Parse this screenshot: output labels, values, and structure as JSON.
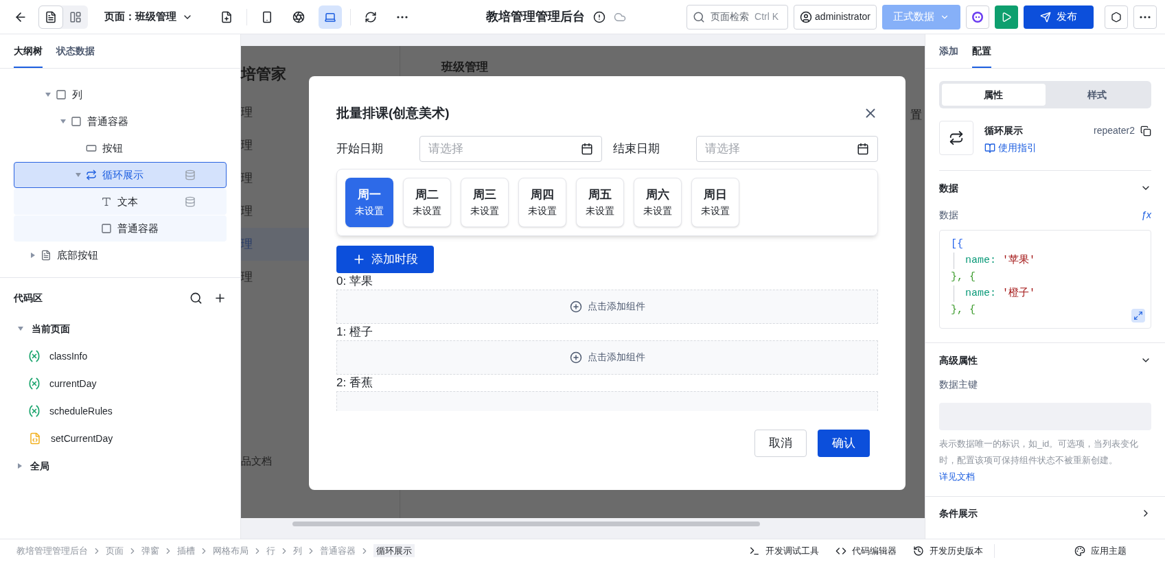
{
  "toolbar": {
    "view_modes": [
      {
        "kind": "page",
        "selected": true
      },
      {
        "kind": "layout",
        "selected": false
      }
    ],
    "page_selector": "页面：班级管理",
    "devices": [
      {
        "kind": "new-page",
        "selected": false
      },
      {
        "kind": "phone",
        "selected": false
      },
      {
        "kind": "mini",
        "selected": false
      },
      {
        "kind": "laptop",
        "selected": true
      },
      {
        "kind": "refresh",
        "selected": false
      },
      {
        "kind": "more",
        "selected": false
      }
    ],
    "title": "教培管理管理后台",
    "search": {
      "placeholder": "页面检索",
      "shortcut": "Ctrl K"
    },
    "user": "administrator",
    "environment": "正式数据",
    "publish": "发布"
  },
  "left_panel": {
    "tabs": [
      {
        "label": "大纲树",
        "selected": true
      },
      {
        "label": "状态数据",
        "selected": false
      }
    ],
    "outline": [
      {
        "children": [
          {
            "label": "列",
            "kind": "container",
            "expanded": true,
            "selected": false,
            "bound": false,
            "children": [
              {
                "label": "普通容器",
                "kind": "container",
                "expanded": true,
                "selected": false,
                "bound": false,
                "children": [
                  {
                    "label": "按钮",
                    "kind": "button",
                    "selected": false,
                    "bound": false
                  },
                  {
                    "label": "循环展示",
                    "kind": "repeater",
                    "expanded": true,
                    "selected": true,
                    "bound": true,
                    "children": [
                      {
                        "label": "文本",
                        "kind": "text",
                        "selected": false,
                        "bound": true
                      },
                      {
                        "label": "普通容器",
                        "kind": "container",
                        "selected": false,
                        "bound": false
                      }
                    ]
                  }
                ]
              }
            ]
          }
        ]
      },
      {
        "label": "底部按钮",
        "kind": "footer",
        "expanded": false,
        "selected": false,
        "bound": false
      }
    ],
    "code_area": {
      "title": "代码区",
      "groups": [
        {
          "label": "当前页面",
          "expanded": true,
          "items": [
            {
              "label": "classInfo",
              "kind": "variable"
            },
            {
              "label": "currentDay",
              "kind": "variable"
            },
            {
              "label": "scheduleRules",
              "kind": "variable"
            },
            {
              "label": "setCurrentDay",
              "kind": "function"
            }
          ]
        },
        {
          "label": "全局",
          "expanded": false
        }
      ]
    }
  },
  "canvas": {
    "brand": "培管家",
    "menu": [
      {
        "label": "理",
        "selected": false
      },
      {
        "label": "理",
        "selected": false
      },
      {
        "label": "理",
        "selected": false
      },
      {
        "label": "理",
        "selected": false
      },
      {
        "label": "理",
        "selected": true
      },
      {
        "label": "理",
        "selected": false
      }
    ],
    "menu_footer": "品文档",
    "page_title": "班级管理",
    "reset": "置"
  },
  "modal": {
    "title": "批量排课(创意美术)",
    "date_fields": [
      {
        "label": "开始日期",
        "placeholder": "请选择"
      },
      {
        "label": "结束日期",
        "placeholder": "请选择"
      }
    ],
    "days": [
      {
        "label": "周一",
        "status": "未设置",
        "selected": true
      },
      {
        "label": "周二",
        "status": "未设置",
        "selected": false
      },
      {
        "label": "周三",
        "status": "未设置",
        "selected": false
      },
      {
        "label": "周四",
        "status": "未设置",
        "selected": false
      },
      {
        "label": "周五",
        "status": "未设置",
        "selected": false
      },
      {
        "label": "周六",
        "status": "未设置",
        "selected": false
      },
      {
        "label": "周日",
        "status": "未设置",
        "selected": false
      }
    ],
    "add_button": "添加时段",
    "items": [
      {
        "label": "0: 苹果",
        "action": "点击添加组件"
      },
      {
        "label": "1: 橙子",
        "action": "点击添加组件"
      },
      {
        "label": "2: 香蕉"
      }
    ],
    "cancel": "取消",
    "confirm": "确认"
  },
  "right_panel": {
    "tabs": [
      {
        "label": "添加",
        "selected": false
      },
      {
        "label": "配置",
        "selected": true
      }
    ],
    "segments": [
      {
        "label": "属性",
        "selected": true
      },
      {
        "label": "样式",
        "selected": false
      }
    ],
    "component": {
      "name": "循环展示",
      "id": "repeater2",
      "guide": "使用指引"
    },
    "data_section": {
      "title": "数据",
      "expanded": true,
      "field_label": "数据",
      "formula_button": "ƒx",
      "code": [
        {
          "kind": "open",
          "text": "[{"
        },
        {
          "kind": "prop",
          "key": "name:",
          "value": "'苹果'"
        },
        {
          "kind": "punct",
          "text": "}, {"
        },
        {
          "kind": "prop",
          "key": "name:",
          "value": "'橙子'"
        },
        {
          "kind": "punct",
          "text": "}, {"
        }
      ]
    },
    "advanced_section": {
      "title": "高级属性",
      "expanded": true,
      "field_label": "数据主键",
      "help": "表示数据唯一的标识，如_id。可选项，当列表变化时，配置该项可保持组件状态不被重新创建。",
      "help_link": "详见文档"
    },
    "condition_section": {
      "title": "条件展示",
      "expanded": false
    }
  },
  "status_bar": {
    "breadcrumbs": [
      "教培管理管理后台",
      "页面",
      "弹窗",
      "插槽",
      "网格布局",
      "行",
      "列",
      "普通容器",
      "循环展示"
    ],
    "tools": [
      {
        "kind": "debug",
        "label": "开发调试工具"
      },
      {
        "kind": "code",
        "label": "代码编辑器"
      },
      {
        "kind": "history",
        "label": "开发历史版本"
      }
    ],
    "theme": "应用主题"
  }
}
